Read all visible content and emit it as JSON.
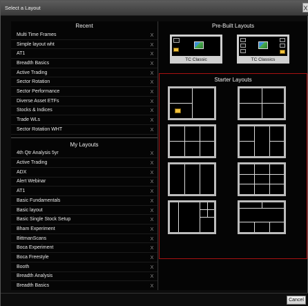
{
  "dialog": {
    "title": "Select a Layout",
    "close_label": "X",
    "cancel_label": "Cancel"
  },
  "recent": {
    "header": "Recent",
    "items": [
      "Multi Time Frames",
      "Simple layout wht",
      "AT1",
      "Breadth Basics",
      "Active Trading",
      "Sector Rotation",
      "Sector Performance",
      "Diverse Asset ETFs",
      "Stocks & Indices",
      "Trade WLs",
      "Sector Rotation WHT"
    ]
  },
  "my_layouts": {
    "header": "My Layouts",
    "items": [
      "4th Qtr Analysis 5yr",
      "Active Trading",
      "ADX",
      "Alert Webinar",
      "AT1",
      "Basic Fundamentals",
      "Basic layout",
      "Basic Single Stock Setup",
      "Bham Experiment",
      "BittmanScans",
      "Boca Experiment",
      "Boca Freestyle",
      "Booth",
      "Breadth Analysis",
      "Breadth Basics"
    ]
  },
  "remove_label": "X",
  "prebuilt": {
    "header": "Pre-Built Layouts",
    "cards": [
      {
        "label": "TC Classic"
      },
      {
        "label": "TC Classics"
      }
    ]
  },
  "starter": {
    "header": "Starter Layouts",
    "border_color": "#aa1111"
  }
}
